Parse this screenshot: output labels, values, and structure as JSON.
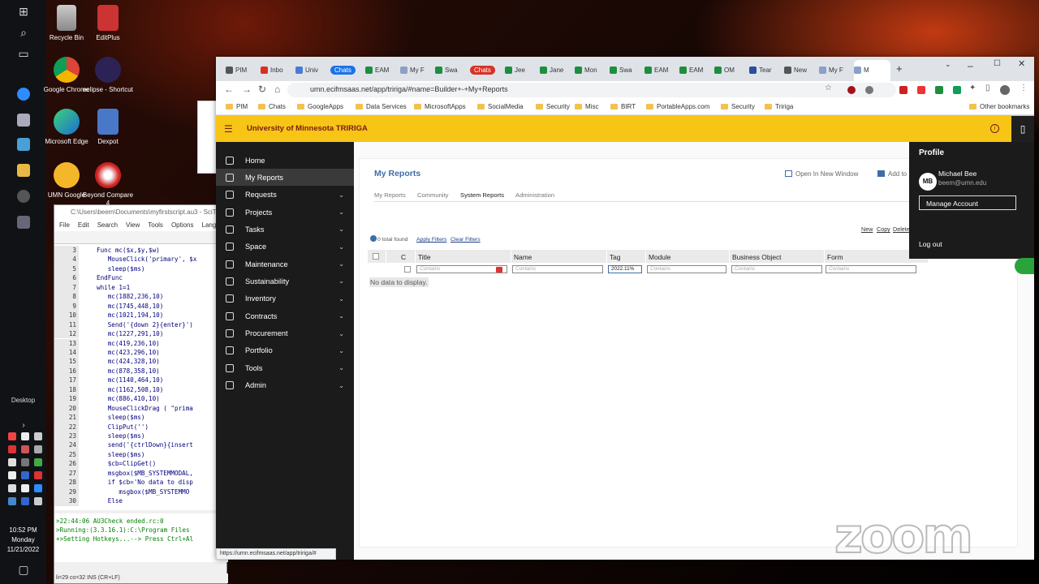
{
  "colors": {
    "tririga_header": "#f7c516",
    "tririga_title": "#7a1b16",
    "sidebar_bg": "#1b1b1b",
    "link_blue": "#3d6ea8"
  },
  "desktop": {
    "icons": [
      {
        "label": "Recycle Bin"
      },
      {
        "label": "EditPlus"
      },
      {
        "label": "Google Chrome"
      },
      {
        "label": "eclipse - Shortcut"
      },
      {
        "label": "Microsoft Edge"
      },
      {
        "label": "Dexpot"
      },
      {
        "label": "UMN Google"
      },
      {
        "label": "Beyond Compare 4"
      }
    ],
    "desktop_label": "Desktop",
    "clock": {
      "time": "10:52 PM",
      "day": "Monday",
      "date": "11/21/2022"
    }
  },
  "editor": {
    "title": "C:\\Users\\beem\\Documents\\myfirstscript.au3 - SciTE",
    "menu": [
      "File",
      "Edit",
      "Search",
      "View",
      "Tools",
      "Options",
      "Language"
    ],
    "lines": [
      {
        "n": "3",
        "code": "Func mc($x,$y,$w)"
      },
      {
        "n": "4",
        "code": "   MouseClick('primary', $x"
      },
      {
        "n": "5",
        "code": "   sleep($ms)"
      },
      {
        "n": "6",
        "code": "EndFunc"
      },
      {
        "n": "7",
        "code": "while 1=1"
      },
      {
        "n": "8",
        "code": "   mc(1882,236,10)"
      },
      {
        "n": "9",
        "code": "   mc(1745,448,10)"
      },
      {
        "n": "10",
        "code": "   mc(1021,194,10)"
      },
      {
        "n": "11",
        "code": "   Send('{down 2}{enter}')"
      },
      {
        "n": "12",
        "code": "   mc(1227,291,10)"
      },
      {
        "n": "13",
        "code": "   mc(419,236,10)"
      },
      {
        "n": "14",
        "code": "   mc(423,296,10)"
      },
      {
        "n": "15",
        "code": "   mc(424,328,10)"
      },
      {
        "n": "16",
        "code": "   mc(878,358,10)"
      },
      {
        "n": "17",
        "code": "   mc(1140,464,10)"
      },
      {
        "n": "18",
        "code": "   mc(1162,508,10)"
      },
      {
        "n": "19",
        "code": "   mc(886,410,10)"
      },
      {
        "n": "20",
        "code": "   MouseClickDrag ( \"prima"
      },
      {
        "n": "21",
        "code": "   sleep($ms)"
      },
      {
        "n": "22",
        "code": "   ClipPut('')"
      },
      {
        "n": "23",
        "code": "   sleep($ms)"
      },
      {
        "n": "24",
        "code": "   send('{ctrlDown}{insert"
      },
      {
        "n": "25",
        "code": "   sleep($ms)"
      },
      {
        "n": "26",
        "code": "   $cb=ClipGet()"
      },
      {
        "n": "27",
        "code": "   msgbox($MB_SYSTEMMODAL,"
      },
      {
        "n": "28",
        "code": "   if $cb='No data to disp"
      },
      {
        "n": "29",
        "code": "      msgbox($MB_SYSTEMMO"
      },
      {
        "n": "30",
        "code": "   Else"
      }
    ],
    "output": [
      ">22:44:06 AU3Check ended.rc:0",
      ">Running:(3.3.16.1):C:\\Program Files",
      "+>Setting Hotkeys...--> Press Ctrl+Al"
    ],
    "status": "li=29 co=32 INS (CR+LF)"
  },
  "browser": {
    "tabs": [
      {
        "label": "PIM",
        "color": "#555"
      },
      {
        "label": "Inbo",
        "color": "#d93025"
      },
      {
        "label": "Univ",
        "color": "#4a7bd0"
      },
      {
        "label": "Chats",
        "color": "#1a73e8",
        "chip": true
      },
      {
        "label": "EAM",
        "color": "#1e8e3e"
      },
      {
        "label": "My F",
        "color": "#8aa0c8"
      },
      {
        "label": "Swa",
        "color": "#1e8e3e"
      },
      {
        "label": "Chats",
        "color": "#d93025",
        "chip": true
      },
      {
        "label": "Jee",
        "color": "#1e8e3e"
      },
      {
        "label": "Jane",
        "color": "#1e8e3e"
      },
      {
        "label": "Mon",
        "color": "#1e8e3e"
      },
      {
        "label": "Swa",
        "color": "#1e8e3e"
      },
      {
        "label": "EAM",
        "color": "#1e8e3e"
      },
      {
        "label": "EAM",
        "color": "#1e8e3e"
      },
      {
        "label": "OM",
        "color": "#1e8e3e"
      },
      {
        "label": "Tear",
        "color": "#2b4da0"
      },
      {
        "label": "New",
        "color": "#555"
      },
      {
        "label": "My F",
        "color": "#8aa0c8"
      },
      {
        "label": "M",
        "color": "#8aa0c8"
      }
    ],
    "url": "umn.ecifmsaas.net/app/tririga/#name=Builder+-+My+Reports",
    "bookmarks": [
      "PIM",
      "Chats",
      "GoogleApps",
      "Data Services",
      "MicrosoftApps",
      "SocialMedia",
      "Security",
      "Misc",
      "BIRT",
      "PortableApps.com",
      "Security",
      "Tririga"
    ],
    "other_bookmarks": "Other bookmarks",
    "status_url": "https://umn.ecifmsaas.net/app/tririga/#"
  },
  "tririga": {
    "title": "University of Minnesota TRIRIGA",
    "nav": [
      {
        "label": "Home",
        "chevron": false
      },
      {
        "label": "My Reports",
        "chevron": false,
        "active": true
      },
      {
        "label": "Requests",
        "chevron": true
      },
      {
        "label": "Projects",
        "chevron": true
      },
      {
        "label": "Tasks",
        "chevron": true
      },
      {
        "label": "Space",
        "chevron": true
      },
      {
        "label": "Maintenance",
        "chevron": true
      },
      {
        "label": "Sustainability",
        "chevron": true
      },
      {
        "label": "Inventory",
        "chevron": true
      },
      {
        "label": "Contracts",
        "chevron": true
      },
      {
        "label": "Procurement",
        "chevron": true
      },
      {
        "label": "Portfolio",
        "chevron": true
      },
      {
        "label": "Tools",
        "chevron": true
      },
      {
        "label": "Admin",
        "chevron": true
      }
    ],
    "page_title": "My Reports",
    "open_new_window": "Open In New Window",
    "add_to": "Add to F",
    "subtabs": [
      "My Reports",
      "Community",
      "System Reports",
      "Administration"
    ],
    "actions": [
      "New",
      "Copy",
      "Delete"
    ],
    "total_found": "0 total found",
    "apply_filters": "Apply Filters",
    "clear_filters": "Clear Filters",
    "columns": [
      "C",
      "Title",
      "Name",
      "Tag",
      "Module",
      "Business Object",
      "Form"
    ],
    "filters": {
      "placeholder": "Contains",
      "tag_value": "2022.11%"
    },
    "no_data": "No data to display."
  },
  "profile": {
    "title": "Profile",
    "initials": "MB",
    "name": "Michael Bee",
    "email": "beem@umn.edu",
    "manage": "Manage Account",
    "logout": "Log out"
  },
  "watermark": "zoom"
}
